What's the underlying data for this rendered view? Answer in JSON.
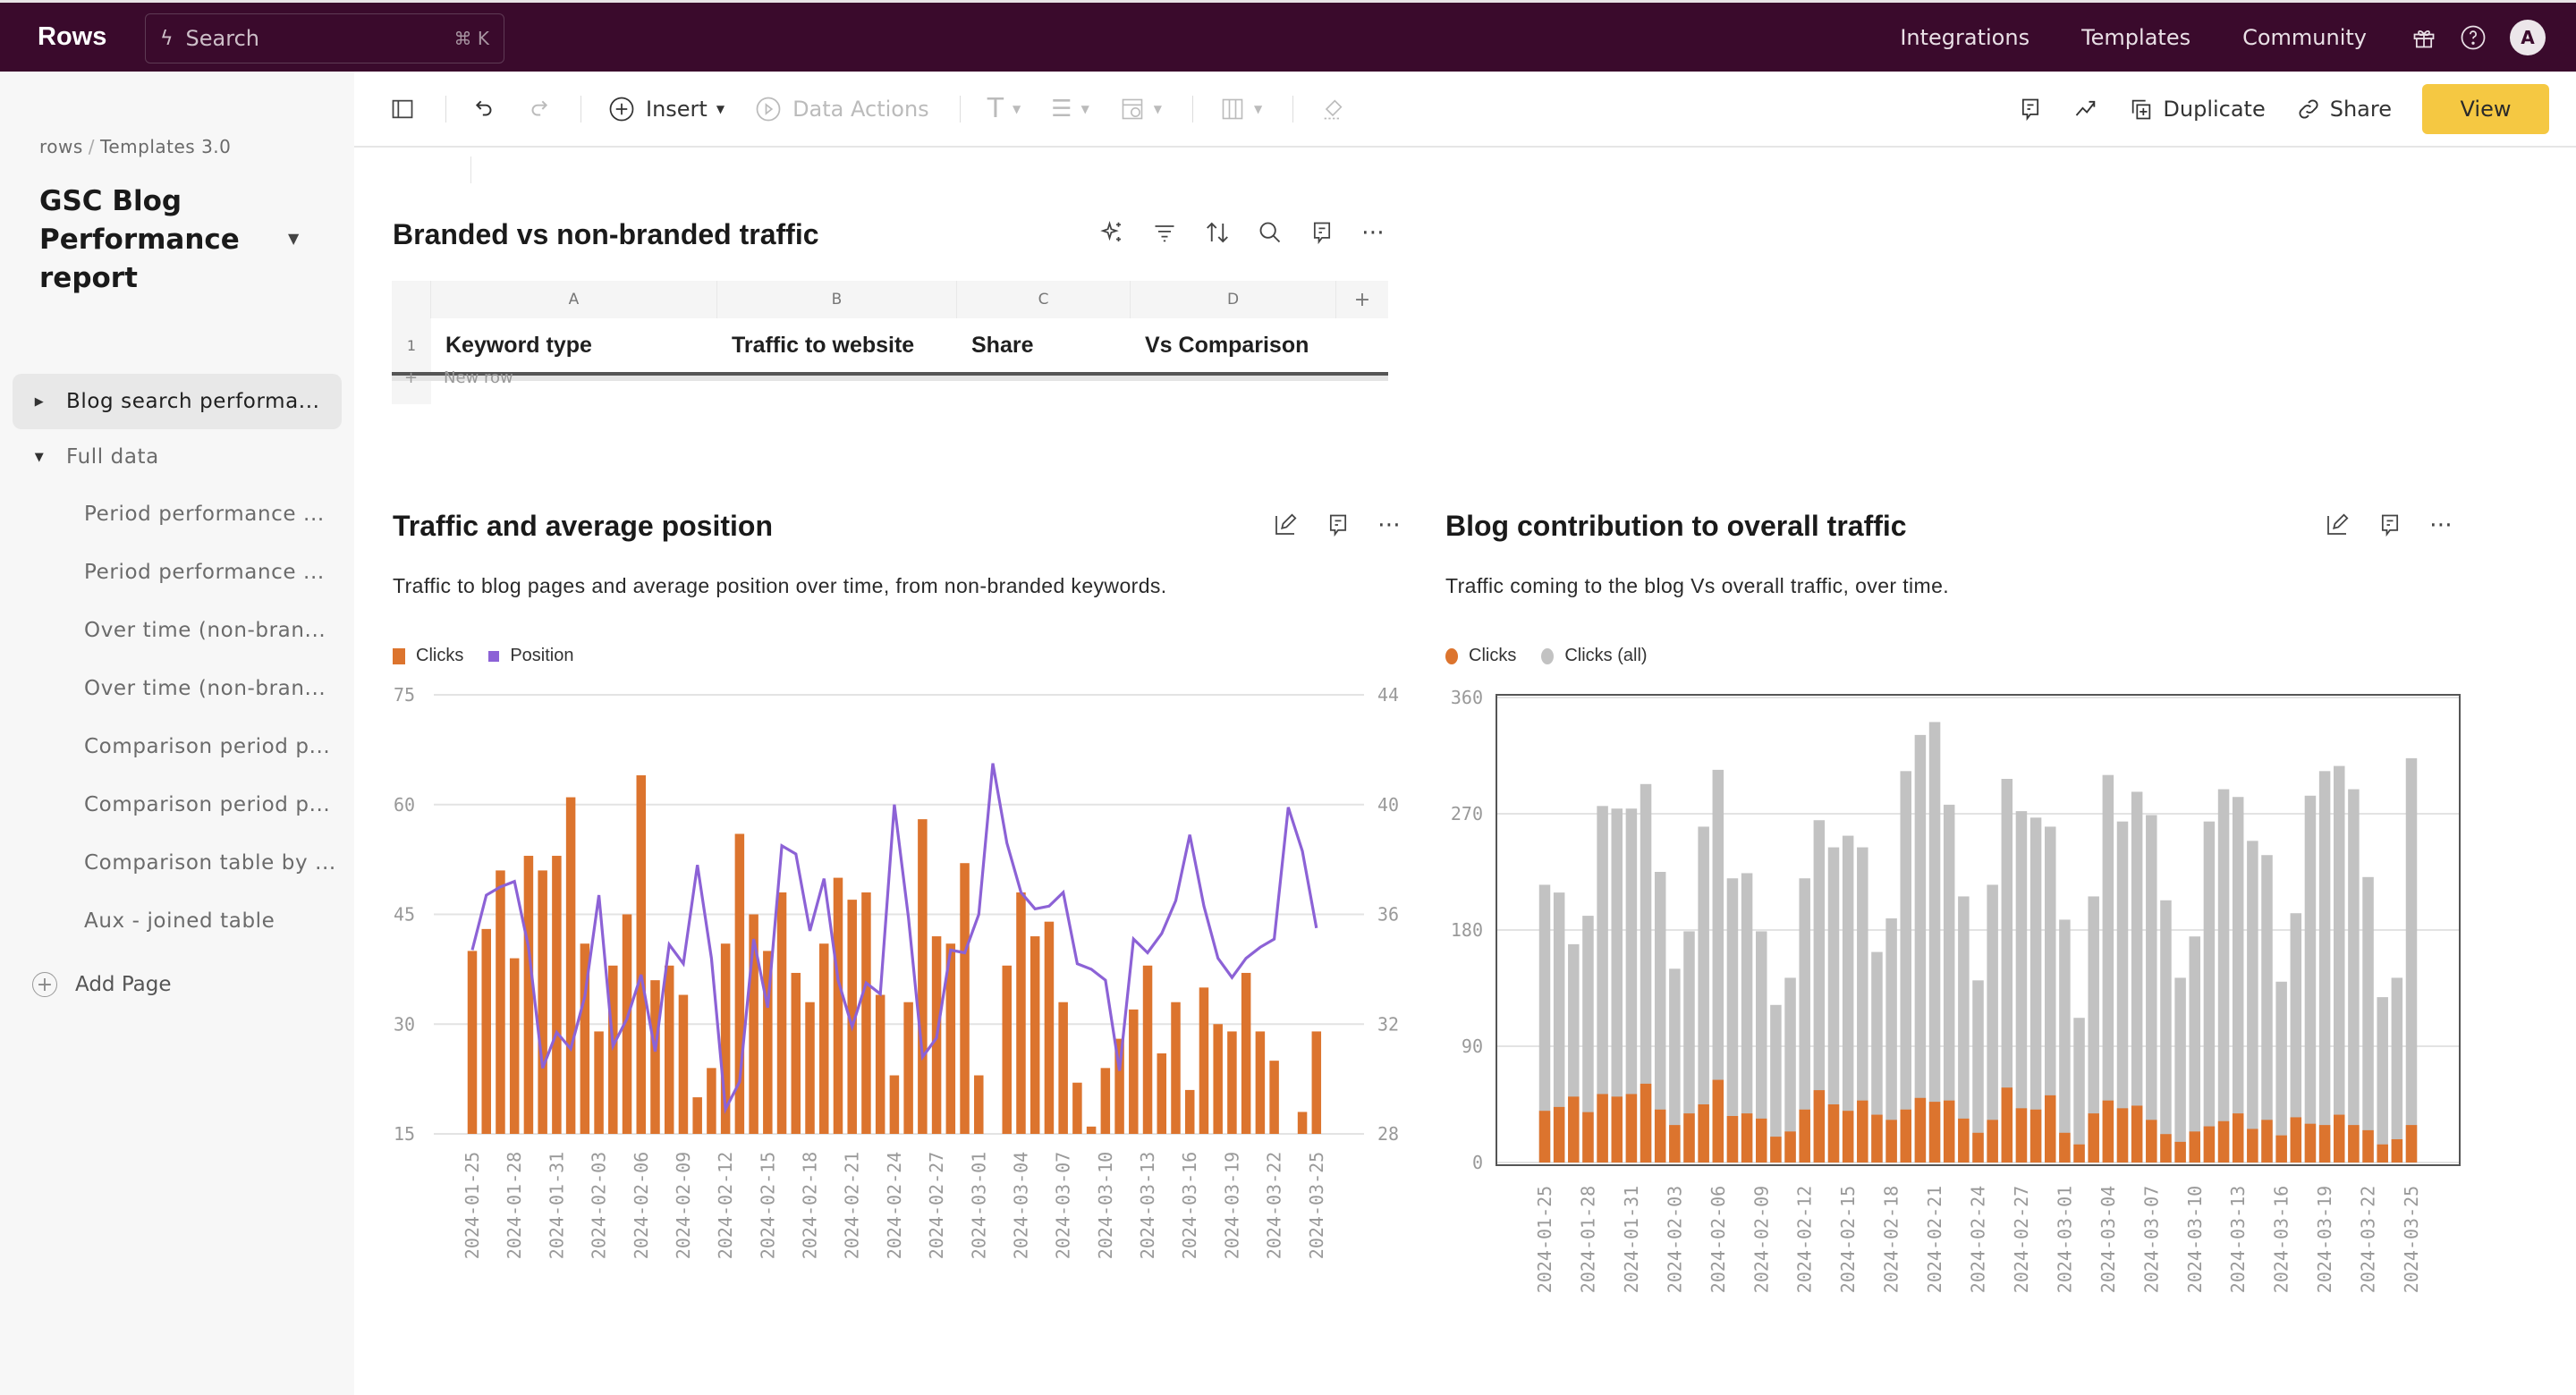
{
  "app": {
    "logo": "Rows",
    "search_placeholder": "Search",
    "search_shortcut": "⌘ K",
    "topnav": [
      "Integrations",
      "Templates",
      "Community"
    ],
    "avatar_initial": "A"
  },
  "sidebar": {
    "breadcrumb": [
      "rows",
      "Templates 3.0"
    ],
    "doc_title": "GSC Blog Performance report",
    "items": [
      {
        "label": "Blog search performa...",
        "active": true,
        "expander": "collapsed"
      },
      {
        "label": "Full data",
        "active": false,
        "expander": "expanded"
      }
    ],
    "children": [
      "Period performance ...",
      "Period performance ...",
      "Over time (non-bran...",
      "Over time (non-bran...",
      "Comparison period p...",
      "Comparison period p...",
      "Comparison table by ...",
      "Aux - joined table"
    ],
    "add_page": "Add Page"
  },
  "toolbar": {
    "insert": "Insert",
    "data_actions": "Data Actions",
    "duplicate": "Duplicate",
    "share": "Share",
    "view": "View"
  },
  "table_block": {
    "title": "Branded vs non-branded traffic",
    "column_letters": [
      "A",
      "B",
      "C",
      "D"
    ],
    "add_column": "+",
    "row_number": "1",
    "headers": [
      "Keyword type",
      "Traffic to website",
      "Share",
      "Vs Comparison"
    ],
    "new_row_label": "New row",
    "new_row_plus": "+"
  },
  "colors": {
    "topbar": "#3a0a2c",
    "accent_button": "#f5c842",
    "clicks": "#dc742e",
    "position": "#8c62d6",
    "clicks_all": "#c2c2c2"
  },
  "chart_data": [
    {
      "type": "bar+line",
      "title": "Traffic and average position",
      "subtitle": "Traffic to blog pages and average position over time, from non-branded keywords.",
      "legend": [
        "Clicks",
        "Position"
      ],
      "legend_position": "top-left",
      "grid": true,
      "ylim_left": [
        15,
        75
      ],
      "yticks_left": [
        15,
        30,
        45,
        60,
        75
      ],
      "ylim_right": [
        28,
        44
      ],
      "yticks_right": [
        28,
        32,
        36,
        40,
        44
      ],
      "xtick_labels": [
        "2024-01-25",
        "2024-01-28",
        "2024-01-31",
        "2024-02-03",
        "2024-02-06",
        "2024-02-09",
        "2024-02-12",
        "2024-02-15",
        "2024-02-18",
        "2024-02-21",
        "2024-02-24",
        "2024-02-27",
        "2024-03-01",
        "2024-03-04",
        "2024-03-07",
        "2024-03-10",
        "2024-03-13",
        "2024-03-16",
        "2024-03-19",
        "2024-03-22",
        "2024-03-25"
      ],
      "x_start": "2024-01-25",
      "x_count": 61,
      "series": [
        {
          "name": "Clicks",
          "kind": "bar",
          "axis": "left",
          "values": [
            40,
            43,
            51,
            39,
            53,
            51,
            53,
            61,
            41,
            29,
            38,
            45,
            64,
            36,
            38,
            34,
            20,
            24,
            41,
            56,
            45,
            40,
            48,
            37,
            33,
            41,
            50,
            47,
            48,
            34,
            23,
            33,
            58,
            42,
            41,
            52,
            23,
            14,
            38,
            48,
            42,
            44,
            33,
            22,
            16,
            24,
            28,
            32,
            38,
            26,
            33,
            21,
            35,
            30,
            29,
            37,
            29,
            25,
            14,
            18,
            29
          ]
        },
        {
          "name": "Position",
          "kind": "line",
          "axis": "right",
          "values": [
            34.7,
            36.7,
            37.0,
            37.2,
            34.8,
            30.4,
            31.7,
            31.1,
            33.0,
            36.7,
            31.2,
            32.2,
            33.8,
            31.0,
            34.9,
            34.2,
            37.8,
            34.4,
            28.9,
            29.9,
            35.1,
            32.6,
            38.5,
            38.2,
            35.4,
            37.3,
            33.6,
            31.9,
            33.5,
            33.1,
            40.0,
            35.9,
            30.8,
            31.5,
            34.7,
            34.6,
            36.0,
            41.5,
            38.6,
            36.8,
            36.2,
            36.3,
            36.8,
            34.2,
            34.0,
            33.6,
            30.3,
            35.1,
            34.6,
            35.3,
            36.5,
            38.9,
            36.3,
            34.4,
            33.7,
            34.4,
            34.8,
            35.1,
            39.9,
            38.3,
            35.5
          ]
        }
      ]
    },
    {
      "type": "bar",
      "title": "Blog contribution to overall traffic",
      "subtitle": "Traffic coming to the blog Vs overall traffic, over time.",
      "legend": [
        "Clicks",
        "Clicks (all)"
      ],
      "legend_position": "top-left",
      "grid": true,
      "ylim": [
        0,
        360
      ],
      "yticks": [
        0,
        90,
        180,
        270,
        360
      ],
      "xtick_labels": [
        "2024-01-25",
        "2024-01-28",
        "2024-01-31",
        "2024-02-03",
        "2024-02-06",
        "2024-02-09",
        "2024-02-12",
        "2024-02-15",
        "2024-02-18",
        "2024-02-21",
        "2024-02-24",
        "2024-02-27",
        "2024-03-01",
        "2024-03-04",
        "2024-03-07",
        "2024-03-10",
        "2024-03-13",
        "2024-03-16",
        "2024-03-19",
        "2024-03-22",
        "2024-03-25"
      ],
      "x_start": "2024-01-25",
      "x_count": 61,
      "series": [
        {
          "name": "Clicks (all)",
          "kind": "bar",
          "values": [
            215,
            209,
            169,
            191,
            276,
            274,
            274,
            293,
            225,
            150,
            179,
            260,
            304,
            220,
            224,
            179,
            122,
            143,
            220,
            265,
            244,
            253,
            244,
            163,
            189,
            303,
            331,
            341,
            277,
            206,
            141,
            215,
            297,
            272,
            267,
            260,
            188,
            112,
            206,
            300,
            264,
            287,
            269,
            203,
            143,
            175,
            264,
            289,
            283,
            249,
            238,
            140,
            193,
            284,
            303,
            307,
            289,
            221,
            128,
            143,
            313
          ]
        },
        {
          "name": "Clicks",
          "kind": "bar",
          "values": [
            40,
            43,
            51,
            39,
            53,
            51,
            53,
            61,
            41,
            29,
            38,
            45,
            64,
            36,
            38,
            34,
            20,
            24,
            41,
            56,
            45,
            40,
            48,
            37,
            33,
            41,
            50,
            47,
            48,
            34,
            23,
            33,
            58,
            42,
            41,
            52,
            23,
            14,
            38,
            48,
            42,
            44,
            33,
            22,
            16,
            24,
            28,
            32,
            38,
            26,
            33,
            21,
            35,
            30,
            29,
            37,
            29,
            25,
            14,
            18,
            29
          ]
        }
      ]
    }
  ]
}
